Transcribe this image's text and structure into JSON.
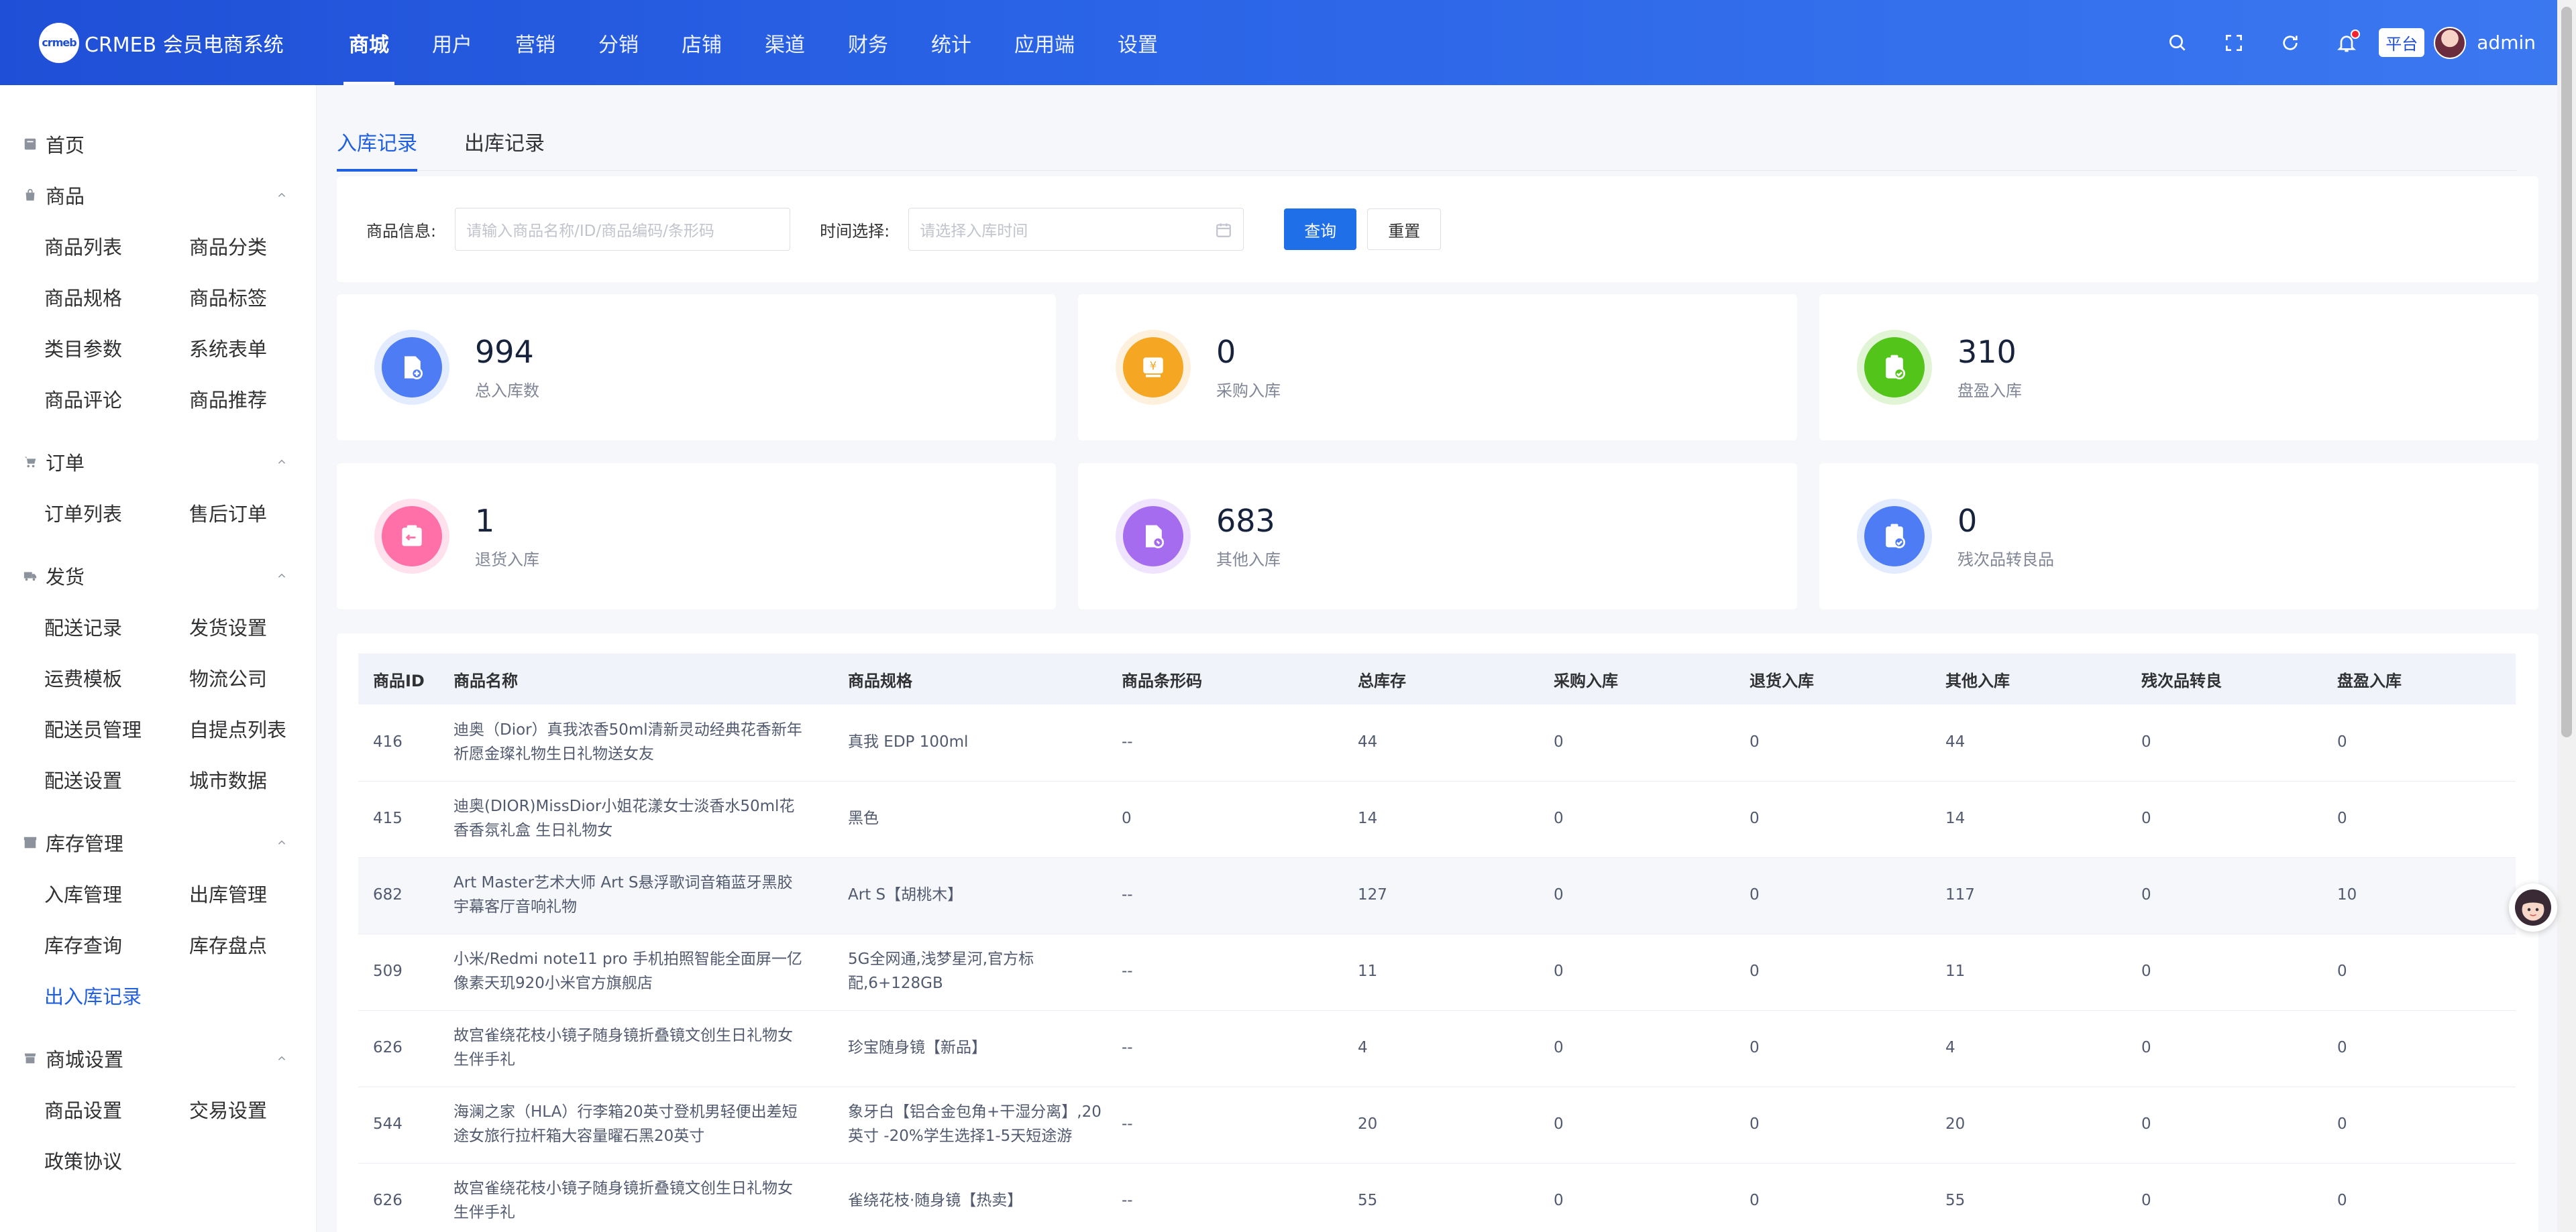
{
  "app": {
    "logo_mark": "crmeb",
    "title": "CRMEB 会员电商系统"
  },
  "topnav": [
    "商城",
    "用户",
    "营销",
    "分销",
    "店铺",
    "渠道",
    "财务",
    "统计",
    "应用端",
    "设置"
  ],
  "header": {
    "platform": "平台",
    "user": "admin"
  },
  "sidebar": {
    "home": "首页",
    "groups": [
      {
        "title": "商品",
        "icon": "bag-icon",
        "items": [
          "商品列表",
          "商品分类",
          "商品规格",
          "商品标签",
          "类目参数",
          "系统表单",
          "商品评论",
          "商品推荐"
        ]
      },
      {
        "title": "订单",
        "icon": "cart-icon",
        "items": [
          "订单列表",
          "售后订单"
        ]
      },
      {
        "title": "发货",
        "icon": "truck-icon",
        "items": [
          "配送记录",
          "发货设置",
          "运费模板",
          "物流公司",
          "配送员管理",
          "自提点列表",
          "配送设置",
          "城市数据"
        ]
      },
      {
        "title": "库存管理",
        "icon": "box-icon",
        "items": [
          "入库管理",
          "出库管理",
          "库存查询",
          "库存盘点",
          "出入库记录"
        ]
      },
      {
        "title": "商城设置",
        "icon": "store-icon",
        "items": [
          "商品设置",
          "交易设置",
          "政策协议"
        ]
      }
    ],
    "active_item": "出入库记录"
  },
  "tabs": [
    "入库记录",
    "出库记录"
  ],
  "filter": {
    "product_label": "商品信息:",
    "product_placeholder": "请输入商品名称/ID/商品编码/条形码",
    "time_label": "时间选择:",
    "time_placeholder": "请选择入库时间",
    "query": "查询",
    "reset": "重置"
  },
  "stats": [
    {
      "value": "994",
      "label": "总入库数",
      "color": "#4e7cf5",
      "ring": "#e3ebff",
      "icon": "doc-add-icon"
    },
    {
      "value": "0",
      "label": "采购入库",
      "color": "#f5a623",
      "ring": "#fdf0dc",
      "icon": "purchase-icon"
    },
    {
      "value": "310",
      "label": "盘盈入库",
      "color": "#52c41a",
      "ring": "#e1f5d6",
      "icon": "clipboard-check-icon"
    },
    {
      "value": "1",
      "label": "退货入库",
      "color": "#ff6fa8",
      "ring": "#ffe1ee",
      "icon": "return-icon"
    },
    {
      "value": "683",
      "label": "其他入库",
      "color": "#a66cf0",
      "ring": "#efe3fd",
      "icon": "doc-other-icon"
    },
    {
      "value": "0",
      "label": "残次品转良品",
      "color": "#4e7cf5",
      "ring": "#e3ebff",
      "icon": "clipboard-convert-icon"
    }
  ],
  "table": {
    "columns": [
      "商品ID",
      "商品名称",
      "商品规格",
      "商品条形码",
      "总库存",
      "采购入库",
      "退货入库",
      "其他入库",
      "残次品转良",
      "盘盈入库"
    ],
    "rows": [
      [
        "416",
        "迪奥（Dior）真我浓香50ml清新灵动经典花香新年祈愿金璨礼物生日礼物送女友",
        "真我 EDP 100ml",
        "--",
        "44",
        "0",
        "0",
        "44",
        "0",
        "0"
      ],
      [
        "415",
        "迪奥(DIOR)MissDior小姐花漾女士淡香水50ml花香香氛礼盒 生日礼物女",
        "黑色",
        "0",
        "14",
        "0",
        "0",
        "14",
        "0",
        "0"
      ],
      [
        "682",
        "Art Master艺术大师 Art S悬浮歌词音箱蓝牙黑胶宇幕客厅音响礼物",
        "Art S【胡桃木】",
        "--",
        "127",
        "0",
        "0",
        "117",
        "0",
        "10"
      ],
      [
        "509",
        "小米/Redmi note11 pro 手机拍照智能全面屏一亿像素天玑920小米官方旗舰店",
        "5G全网通,浅梦星河,官方标配,6+128GB",
        "--",
        "11",
        "0",
        "0",
        "11",
        "0",
        "0"
      ],
      [
        "626",
        "故宫雀绕花枝小镜子随身镜折叠镜文创生日礼物女生伴手礼",
        "珍宝随身镜【新品】",
        "--",
        "4",
        "0",
        "0",
        "4",
        "0",
        "0"
      ],
      [
        "544",
        "海澜之家（HLA）行李箱20英寸登机男轻便出差短途女旅行拉杆箱大容量曜石黑20英寸",
        "象牙白【铝合金包角+干湿分离】,20英寸 -20%学生选择1-5天短途游",
        "--",
        "20",
        "0",
        "0",
        "20",
        "0",
        "0"
      ],
      [
        "626",
        "故宫雀绕花枝小镜子随身镜折叠镜文创生日礼物女生伴手礼",
        "雀绕花枝·随身镜【热卖】",
        "--",
        "55",
        "0",
        "0",
        "55",
        "0",
        "0"
      ]
    ]
  }
}
